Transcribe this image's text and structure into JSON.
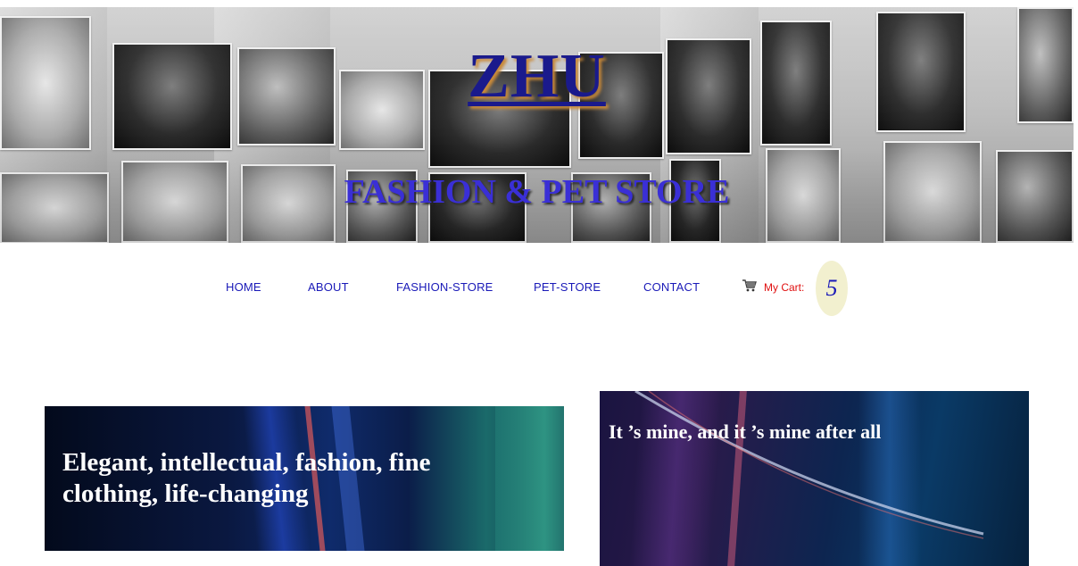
{
  "header": {
    "brand": "ZHU",
    "subtitle": "FASHION & PET STORE"
  },
  "nav": {
    "items": [
      {
        "label": "HOME"
      },
      {
        "label": "ABOUT"
      },
      {
        "label": "FASHION-STORE"
      },
      {
        "label": "PET-STORE"
      },
      {
        "label": "CONTACT"
      }
    ],
    "cart": {
      "icon": "cart-icon",
      "label": "My Cart:",
      "count": "5"
    }
  },
  "cards": [
    {
      "title": "Elegant, intellectual, fashion, fine clothing, life-changing"
    },
    {
      "title": "It ’s mine, and it ’s mine after all"
    }
  ],
  "colors": {
    "brand": "#1a1a8c",
    "subtitle": "#3a2fd6",
    "nav_link": "#1a1ab8",
    "cart_label": "#e01010",
    "cart_badge": "#f2f0cf"
  }
}
